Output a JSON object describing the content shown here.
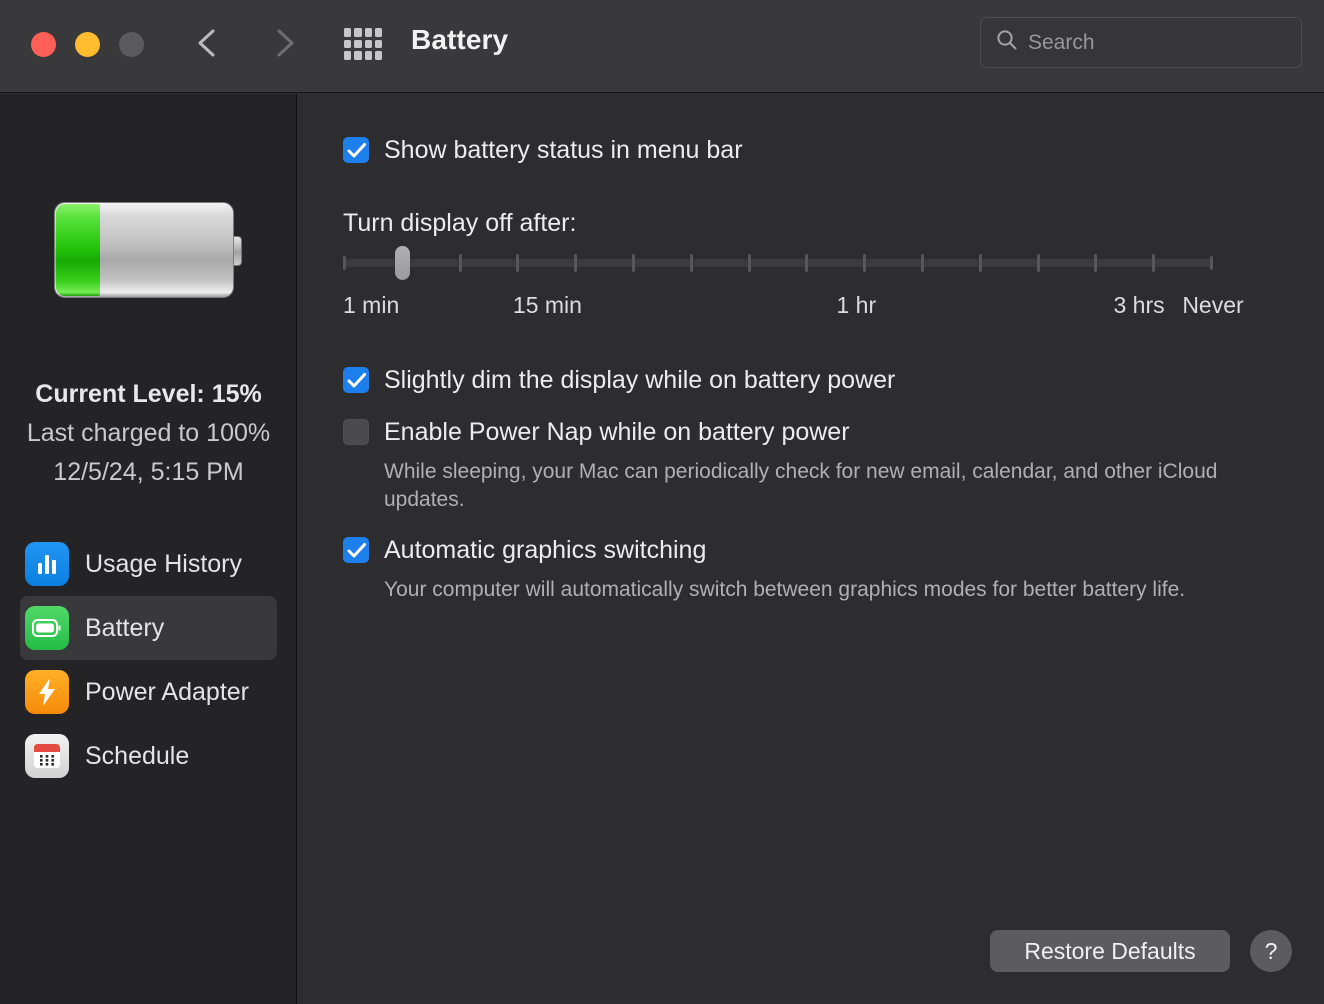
{
  "window": {
    "title": "Battery",
    "traffic_lights": [
      "close",
      "minimize",
      "zoom"
    ]
  },
  "toolbar": {
    "back_icon": "chevron-left-icon",
    "forward_icon": "chevron-right-icon",
    "grid_icon": "grid-apps-icon",
    "title": "Battery",
    "search": {
      "icon": "search-icon",
      "placeholder": "Search",
      "value": ""
    }
  },
  "sidebar": {
    "battery_status": {
      "fill_percent": 15,
      "current_level": "Current Level: 15%",
      "last_charged": "Last charged to 100%",
      "last_charged_date": "12/5/24, 5:15 PM"
    },
    "items": [
      {
        "label": "Usage History",
        "icon": "bar-chart-icon",
        "selected": false
      },
      {
        "label": "Battery",
        "icon": "battery-icon",
        "selected": true
      },
      {
        "label": "Power Adapter",
        "icon": "lightning-bolt-icon",
        "selected": false
      },
      {
        "label": "Schedule",
        "icon": "calendar-icon",
        "selected": false
      }
    ]
  },
  "main": {
    "show_battery_status": {
      "label": "Show battery status in menu bar",
      "checked": true
    },
    "display_off": {
      "label": "Turn display off after:",
      "slider": {
        "value_index": 1,
        "tick_count": 16,
        "labels": [
          {
            "text": "1 min",
            "pos": 0
          },
          {
            "text": "15 min",
            "pos": 0.235
          },
          {
            "text": "1 hr",
            "pos": 0.59
          },
          {
            "text": "3 hrs",
            "pos": 0.915
          },
          {
            "text": "Never",
            "pos": 1.0
          }
        ]
      }
    },
    "options": [
      {
        "label": "Slightly dim the display while on battery power",
        "checked": true,
        "description": ""
      },
      {
        "label": "Enable Power Nap while on battery power",
        "checked": false,
        "description": "While sleeping, your Mac can periodically check for new email, calendar, and other iCloud updates."
      },
      {
        "label": "Automatic graphics switching",
        "checked": true,
        "description": "Your computer will automatically switch between graphics modes for better battery life."
      }
    ],
    "restore_defaults_label": "Restore Defaults",
    "help_label": "?"
  },
  "colors": {
    "accent": "#1d7fec",
    "battery_green": "#22c40a",
    "toolbar_bg": "#39393b",
    "sidebar_bg": "#242426",
    "content_bg": "#2d2d2f"
  }
}
